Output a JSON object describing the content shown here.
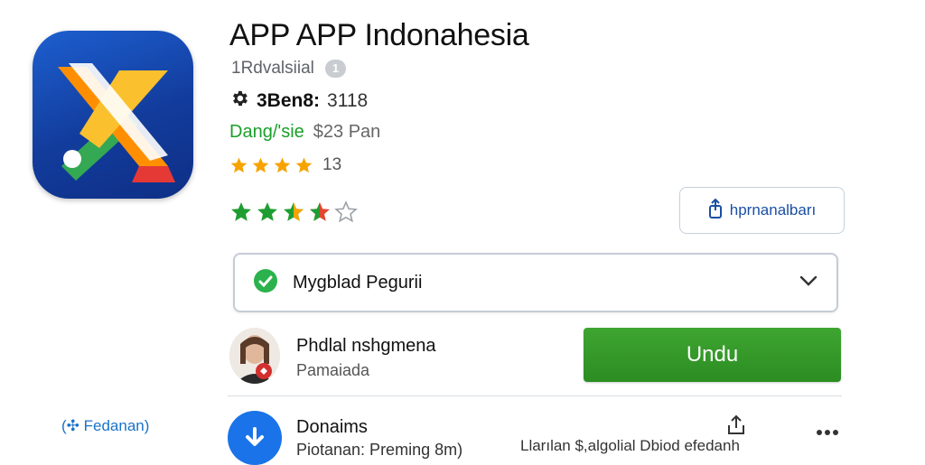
{
  "app": {
    "title": "APP APP Indonahesia",
    "developer": "1Rdvalsiial",
    "developer_badge": "1",
    "version_label": "3Ben8:",
    "version_value": "3118",
    "price_label": "Dang/'sie",
    "price_value": "$23 Pan",
    "rating_stars": 4,
    "rating_count": "13",
    "rating2_value": 3.5
  },
  "share": {
    "label": "hprnanalbarı",
    "icon": "share-icon"
  },
  "dropdown": {
    "label": "Mygblad Pegurii",
    "icon": "check-circle-icon"
  },
  "reviewer": {
    "name": "Phdlal nshgmena",
    "sub": "Pamaiada"
  },
  "download": {
    "label": "Undu"
  },
  "side_link": {
    "label": "(✣ Fedanan)"
  },
  "downloads": {
    "title": "Donaims",
    "sub": "Piotanan: Preming 8m)",
    "meta": "Llarılan $,algolial Dbiod efedanh"
  },
  "colors": {
    "brand_green": "#2f9a25",
    "price_green": "#1a9f2a",
    "star_gold": "#f6a300",
    "star_green": "#1e9e32",
    "link_blue": "#1a73c8",
    "icon_blue": "#1a5fd0"
  }
}
